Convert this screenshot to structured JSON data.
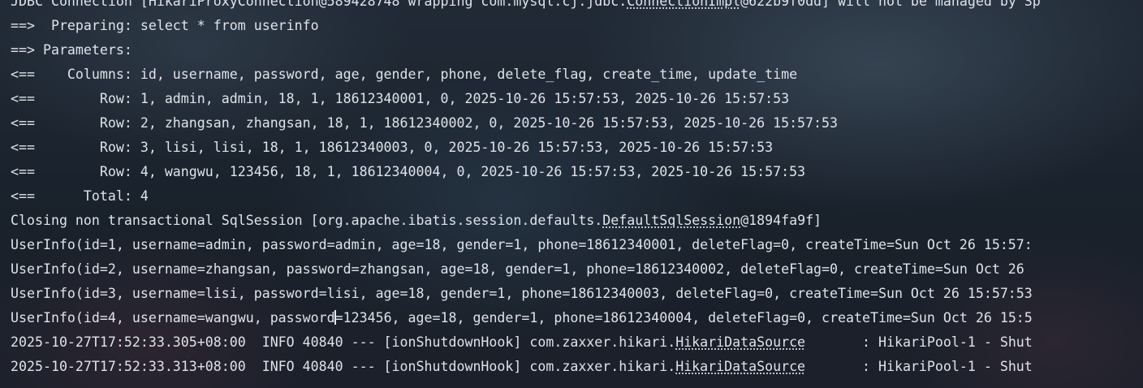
{
  "console": {
    "lines": [
      "JDBC Connection [HikariProxyConnection@589428748 wrapping com.mysql.cj.jdbc.ConnectionImpl@622b9f0dd] will not be managed by Sp",
      "==>  Preparing: select * from userinfo",
      "==> Parameters: ",
      "<==    Columns: id, username, password, age, gender, phone, delete_flag, create_time, update_time",
      "<==        Row: 1, admin, admin, 18, 1, 18612340001, 0, 2025-10-26 15:57:53, 2025-10-26 15:57:53",
      "<==        Row: 2, zhangsan, zhangsan, 18, 1, 18612340002, 0, 2025-10-26 15:57:53, 2025-10-26 15:57:53",
      "<==        Row: 3, lisi, lisi, 18, 1, 18612340003, 0, 2025-10-26 15:57:53, 2025-10-26 15:57:53",
      "<==        Row: 4, wangwu, 123456, 18, 1, 18612340004, 0, 2025-10-26 15:57:53, 2025-10-26 15:57:53",
      "<==      Total: 4",
      "Closing non transactional SqlSession [org.apache.ibatis.session.defaults.DefaultSqlSession@1894fa9f]",
      "UserInfo(id=1, username=admin, password=admin, age=18, gender=1, phone=18612340001, deleteFlag=0, createTime=Sun Oct 26 15:57:",
      "UserInfo(id=2, username=zhangsan, password=zhangsan, age=18, gender=1, phone=18612340002, deleteFlag=0, createTime=Sun Oct 26 ",
      "UserInfo(id=3, username=lisi, password=lisi, age=18, gender=1, phone=18612340003, deleteFlag=0, createTime=Sun Oct 26 15:57:53",
      "UserInfo(id=4, username=wangwu, password=123456, age=18, gender=1, phone=18612340004, deleteFlag=0, createTime=Sun Oct 26 15:5",
      "2025-10-27T17:52:33.305+08:00  INFO 40840 --- [ionShutdownHook] com.zaxxer.hikari.HikariDataSource       : HikariPool-1 - Shut",
      "2025-10-27T17:52:33.313+08:00  INFO 40840 --- [ionShutdownHook] com.zaxxer.hikari.HikariDataSource       : HikariPool-1 - Shut"
    ],
    "underlined_terms": [
      "ConnectionImpl",
      "DefaultSqlSession",
      "HikariDataSource"
    ],
    "caret_after": "username=wangwu, password"
  },
  "colors": {
    "text": "#dfe3e8",
    "background": "#1f2a36"
  }
}
